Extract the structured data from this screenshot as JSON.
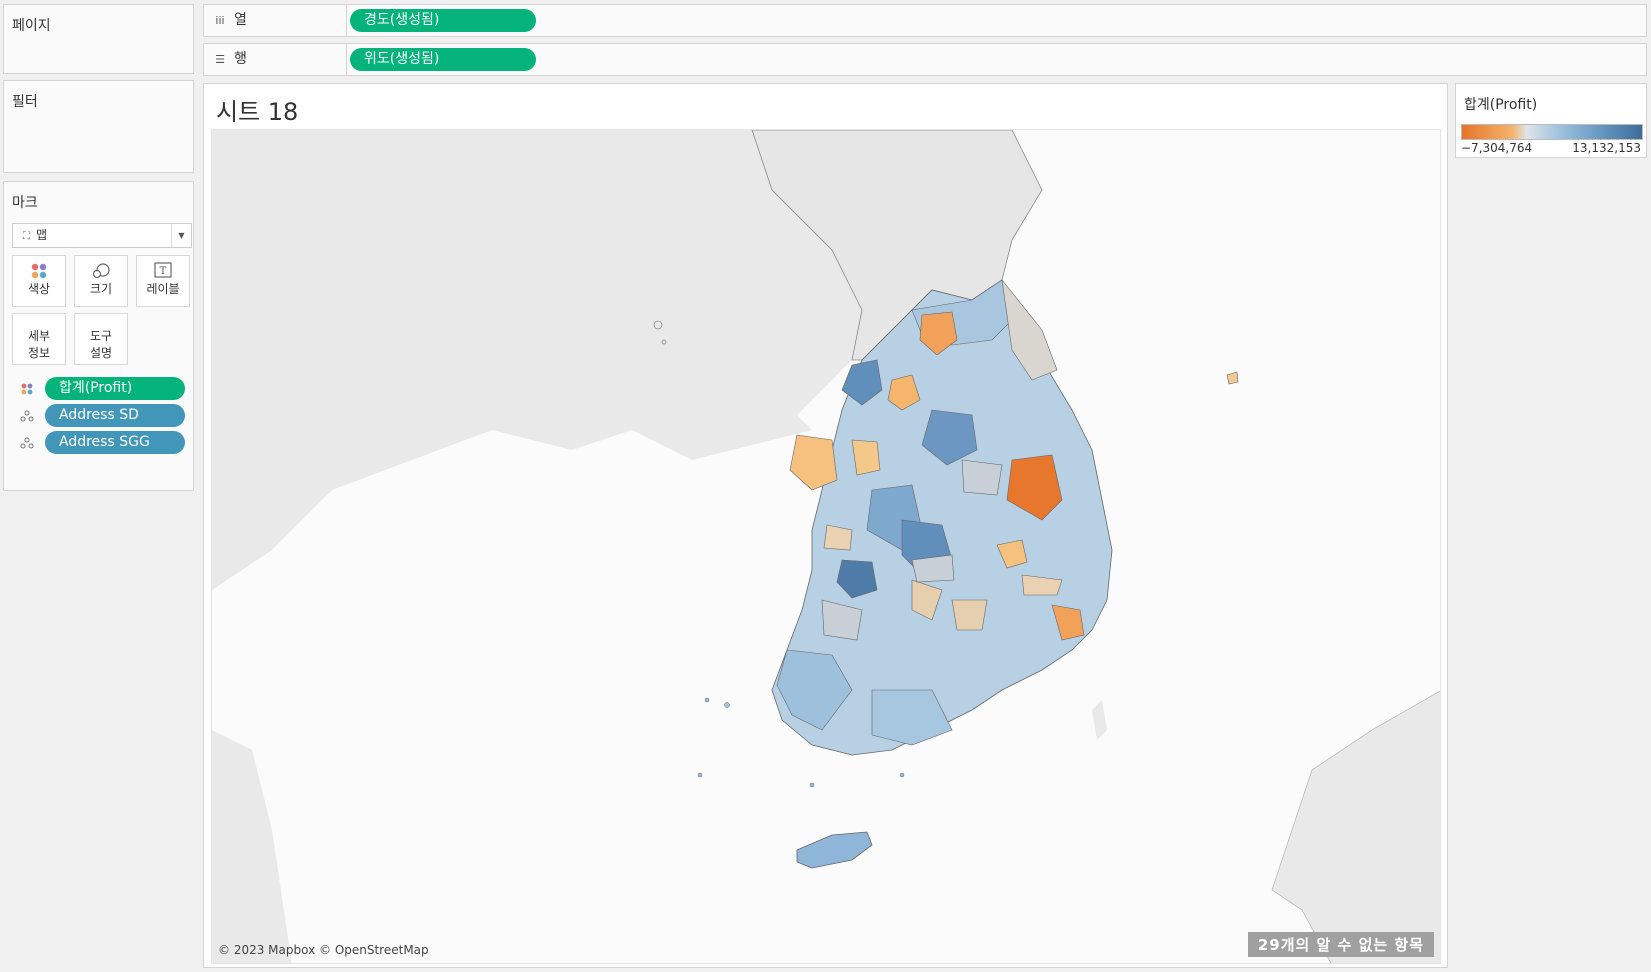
{
  "left_panel": {
    "pages_label": "페이지",
    "filters_label": "필터",
    "marks_label": "마크",
    "mark_type": "맵",
    "buttons": {
      "color": "색상",
      "size": "크기",
      "label": "레이블",
      "detail_line1": "세부",
      "detail_line2": "정보",
      "tooltip_line1": "도구",
      "tooltip_line2": "설명"
    },
    "fields": [
      {
        "name": "합계(Profit)",
        "icon": "color-dots-icon",
        "color": "#03b37a"
      },
      {
        "name": "Address SD",
        "icon": "detail-dots-icon",
        "color": "#4296b9"
      },
      {
        "name": "Address SGG",
        "icon": "detail-dots-icon",
        "color": "#4296b9"
      }
    ]
  },
  "shelves": {
    "columns_label": "열",
    "columns_icon": "columns-icon",
    "columns_pill": "경도(생성됨)",
    "rows_label": "행",
    "rows_icon": "rows-icon",
    "rows_pill": "위도(생성됨)"
  },
  "view": {
    "sheet_title": "시트 18",
    "attribution": "© 2023 Mapbox © OpenStreetMap",
    "unknown_items": "29개의 알 수 없는 항목"
  },
  "legend": {
    "title": "합계(Profit)",
    "min": "−7,304,764",
    "max": "13,132,153",
    "colors": [
      "#e8732a",
      "#f4b36c",
      "#dfe4ea",
      "#9cc1dd",
      "#3d6c9c"
    ]
  }
}
